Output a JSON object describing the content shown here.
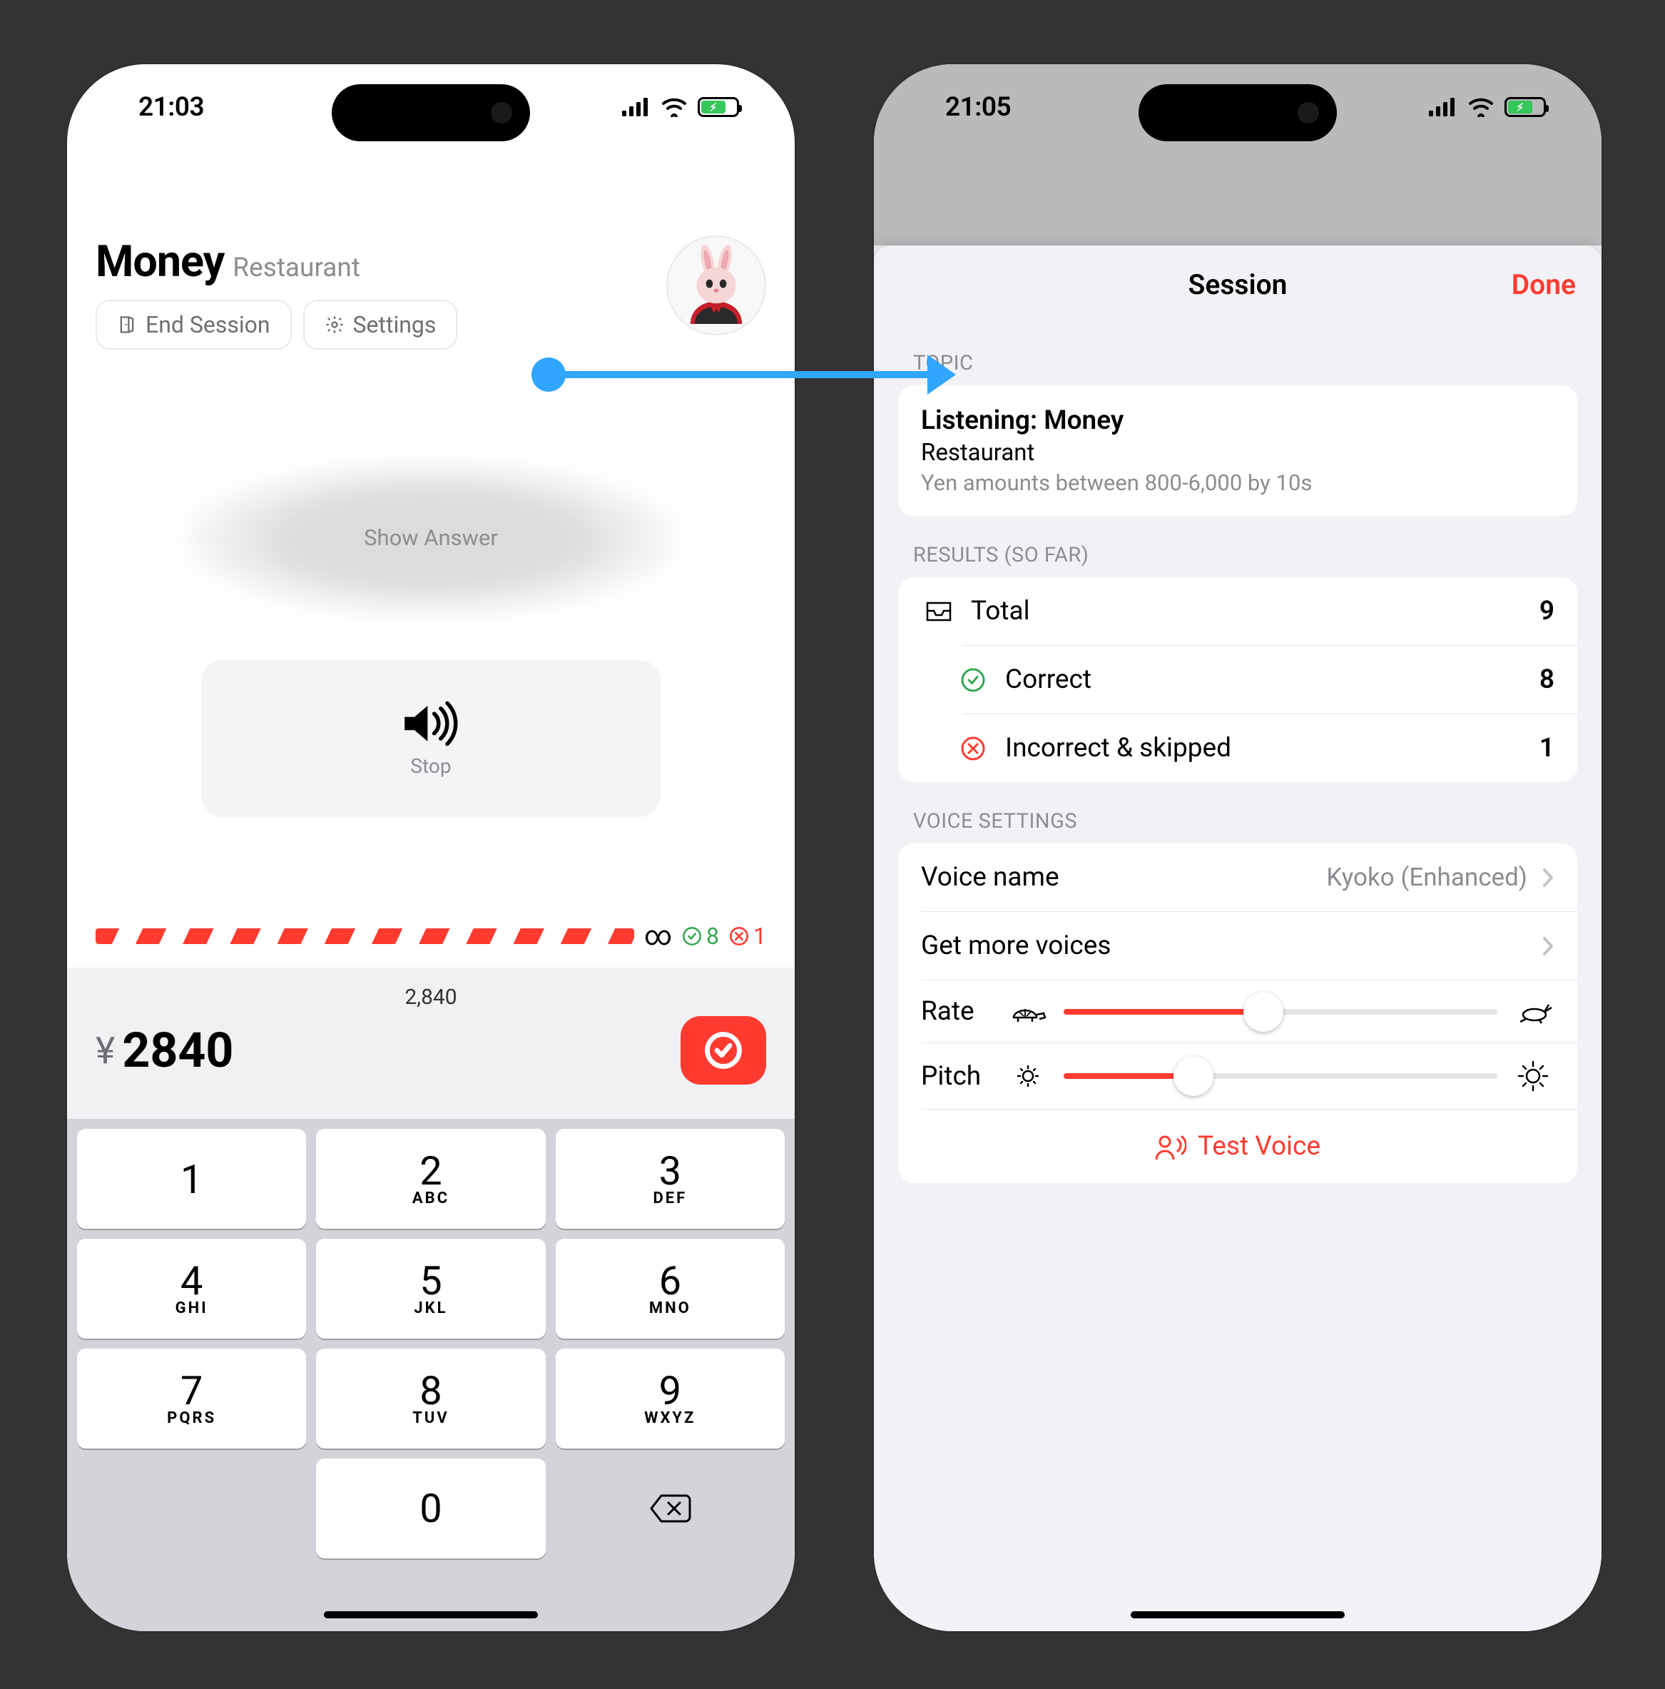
{
  "left": {
    "time": "21:03",
    "title": "Money",
    "subtitle": "Restaurant",
    "endSession": "End Session",
    "settings": "Settings",
    "showAnswer": "Show Answer",
    "stop": "Stop",
    "infinity": "∞",
    "scoreCorrect": "8",
    "scoreWrong": "1",
    "prevAmount": "2,840",
    "currencySymbol": "¥",
    "enteredAmount": "2840",
    "keys": [
      {
        "n": "1",
        "l": ""
      },
      {
        "n": "2",
        "l": "ABC"
      },
      {
        "n": "3",
        "l": "DEF"
      },
      {
        "n": "4",
        "l": "GHI"
      },
      {
        "n": "5",
        "l": "JKL"
      },
      {
        "n": "6",
        "l": "MNO"
      },
      {
        "n": "7",
        "l": "PQRS"
      },
      {
        "n": "8",
        "l": "TUV"
      },
      {
        "n": "9",
        "l": "WXYZ"
      }
    ],
    "zero": "0"
  },
  "right": {
    "time": "21:05",
    "navTitle": "Session",
    "done": "Done",
    "topicHeader": "TOPIC",
    "topicTitle": "Listening: Money",
    "topicSubtitle": "Restaurant",
    "topicDescription": "Yen amounts between 800-6,000 by 10s",
    "resultsHeader": "RESULTS (SO FAR)",
    "totalLabel": "Total",
    "totalValue": "9",
    "correctLabel": "Correct",
    "correctValue": "8",
    "incorrectLabel": "Incorrect & skipped",
    "incorrectValue": "1",
    "voiceHeader": "VOICE SETTINGS",
    "voiceNameLabel": "Voice name",
    "voiceNameValue": "Kyoko (Enhanced)",
    "moreVoicesLabel": "Get more voices",
    "rateLabel": "Rate",
    "ratePercent": 46,
    "pitchLabel": "Pitch",
    "pitchPercent": 30,
    "testVoice": "Test Voice"
  }
}
